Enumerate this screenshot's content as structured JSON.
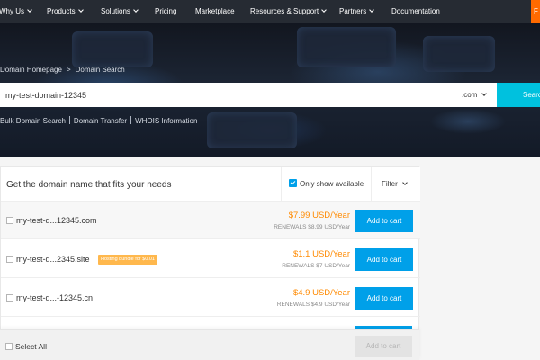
{
  "nav": {
    "items": [
      {
        "label": "Why Us",
        "has_menu": true
      },
      {
        "label": "Products",
        "has_menu": true
      },
      {
        "label": "Solutions",
        "has_menu": true
      },
      {
        "label": "Pricing",
        "has_menu": false
      },
      {
        "label": "Marketplace",
        "has_menu": false
      },
      {
        "label": "Resources & Support",
        "has_menu": true
      },
      {
        "label": "Partners",
        "has_menu": true
      },
      {
        "label": "Documentation",
        "has_menu": false
      }
    ],
    "cta_partial": "F"
  },
  "breadcrumb": {
    "home": "Domain Homepage",
    "separator": ">",
    "current": "Domain Search"
  },
  "search": {
    "value": "my-test-domain-12345",
    "tld": ".com",
    "button_label": "Search"
  },
  "sublinks": [
    "Bulk Domain Search",
    "Domain Transfer",
    "WHOIS Information"
  ],
  "results": {
    "title": "Get the domain name that fits your needs",
    "only_available_label": "Only show available",
    "only_available_checked": true,
    "filter_label": "Filter",
    "rows": [
      {
        "domain": "my-test-d...12345.com",
        "badge": "",
        "price": "$7.99 USD/Year",
        "renewal": "RENEWALS $8.99 USD/Year",
        "button": "Add to cart"
      },
      {
        "domain": "my-test-d...2345.site",
        "badge": "Hosting bundle for $0.01",
        "price": "$1.1 USD/Year",
        "renewal": "RENEWALS $7 USD/Year",
        "button": "Add to cart"
      },
      {
        "domain": "my-test-d...-12345.cn",
        "badge": "",
        "price": "$4.9 USD/Year",
        "renewal": "RENEWALS $4.9 USD/Year",
        "button": "Add to cart"
      }
    ],
    "select_all_label": "Select All",
    "footer_button": "Add to cart"
  },
  "colors": {
    "nav_bg": "#262b33",
    "accent_blue": "#00a0e9",
    "search_button": "#00c1de",
    "price_orange": "#ff8a00",
    "badge_orange": "#ffb84d",
    "cta_orange": "#ff6a00"
  }
}
